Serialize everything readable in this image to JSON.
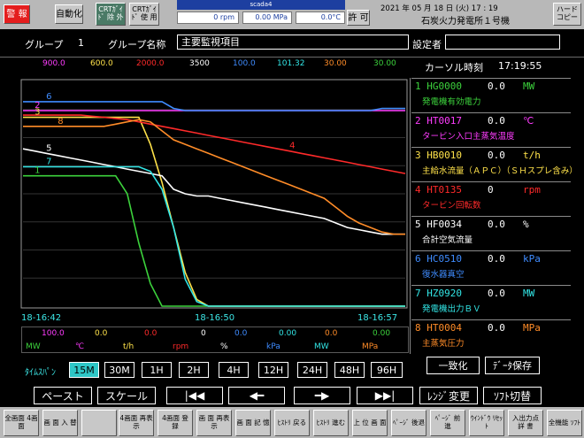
{
  "colors": {
    "s1": "#3cd23c",
    "s2": "#ff3cff",
    "s3": "#ffe24a",
    "s4": "#ff2a2a",
    "s5": "#ffffff",
    "s6": "#3f8cff",
    "s7": "#32e6e6",
    "s8": "#ff8c28"
  },
  "topbar": {
    "alarm": "警 報",
    "auto": "自動化",
    "crt1": "CRTｶﾞｲﾄﾞ 除 外",
    "crt2": "CRTｶﾞｲﾄﾞ 使 用",
    "win_title": "scada4",
    "rpm": "0 rpm",
    "mpa": "0.00 MPa",
    "temp": "0.0°C",
    "permit": "許 可",
    "datetime": "2021 年 05 月 18 日 (火)  17 : 19",
    "plant": "石炭火力発電所１号機",
    "hardcopy": "ハード コピー"
  },
  "header": {
    "group_label": "グループ",
    "group_no": "1",
    "group_name_label": "グループ名称",
    "group_name": "主要監視項目",
    "setter_label": "設定者",
    "setter": ""
  },
  "scale_top": [
    "900.0",
    "600.0",
    "2000.0",
    "3500",
    "100.0",
    "101.32",
    "30.00",
    "30.00"
  ],
  "cursor": {
    "label": "カーソル時刻",
    "time": "17:19:55"
  },
  "chart_data": {
    "type": "line",
    "x": [
      "18-16:42",
      "18-16:50",
      "18-16:57"
    ],
    "y_normalized_range": [
      0,
      1
    ],
    "series": [
      {
        "name": "1",
        "values": [
          0.58,
          0.58,
          0.58,
          0.58,
          0.58,
          0.58,
          0.58,
          0.58,
          0.58,
          0.5,
          0.28,
          0.1,
          0,
          0,
          0,
          0,
          0,
          0,
          0,
          0,
          0,
          0,
          0,
          0,
          0,
          0,
          0,
          0,
          0,
          0,
          0,
          0,
          0,
          0
        ]
      },
      {
        "name": "2",
        "values": [
          0.87,
          0.87,
          0.87,
          0.87,
          0.87,
          0.87,
          0.87,
          0.87,
          0.87,
          0.87,
          0.87,
          0.87,
          0.87,
          0.87,
          0.87,
          0.87,
          0.87,
          0.87,
          0.87,
          0.87,
          0.87,
          0.87,
          0.87,
          0.87,
          0.87,
          0.87,
          0.87,
          0.87,
          0.87,
          0.87,
          0.87,
          0.87,
          0.87,
          0.87
        ]
      },
      {
        "name": "3",
        "values": [
          0.84,
          0.84,
          0.84,
          0.84,
          0.84,
          0.84,
          0.84,
          0.84,
          0.84,
          0.84,
          0.84,
          0.72,
          0.55,
          0.35,
          0.15,
          0.03,
          0,
          0,
          0,
          0,
          0,
          0,
          0,
          0,
          0,
          0,
          0,
          0,
          0,
          0,
          0,
          0,
          0,
          0
        ]
      },
      {
        "name": "4",
        "values": [
          0.85,
          0.85,
          0.85,
          0.85,
          0.85,
          0.85,
          0.845,
          0.84,
          0.835,
          0.83,
          0.82,
          0.81,
          0.8,
          0.79,
          0.78,
          0.77,
          0.76,
          0.75,
          0.74,
          0.73,
          0.72,
          0.71,
          0.7,
          0.69,
          0.68,
          0.67,
          0.66,
          0.65,
          0.64,
          0.63,
          0.62,
          0.61,
          0.6,
          0.59
        ]
      },
      {
        "name": "5",
        "values": [
          0.7,
          0.69,
          0.68,
          0.67,
          0.66,
          0.65,
          0.64,
          0.63,
          0.62,
          0.61,
          0.6,
          0.59,
          0.58,
          0.52,
          0.5,
          0.49,
          0.49,
          0.48,
          0.47,
          0.46,
          0.45,
          0.44,
          0.43,
          0.42,
          0.41,
          0.4,
          0.39,
          0.37,
          0.35,
          0.34,
          0.33,
          0.32,
          0.32,
          0.32
        ]
      },
      {
        "name": "6",
        "values": [
          0.91,
          0.91,
          0.91,
          0.91,
          0.91,
          0.91,
          0.91,
          0.91,
          0.91,
          0.91,
          0.91,
          0.91,
          0.91,
          0.88,
          0.87,
          0.87,
          0.87,
          0.87,
          0.87,
          0.87,
          0.87,
          0.87,
          0.87,
          0.87,
          0.87,
          0.87,
          0.87,
          0.87,
          0.87,
          0.87,
          0.87,
          0.88,
          0.88,
          0.88
        ]
      },
      {
        "name": "7",
        "values": [
          0.62,
          0.62,
          0.62,
          0.62,
          0.62,
          0.62,
          0.62,
          0.62,
          0.62,
          0.62,
          0.62,
          0.6,
          0.52,
          0.35,
          0.12,
          0.02,
          0,
          0,
          0,
          0,
          0,
          0,
          0,
          0,
          0,
          0,
          0,
          0,
          0,
          0,
          0,
          0,
          0,
          0
        ]
      },
      {
        "name": "8",
        "values": [
          0.8,
          0.8,
          0.8,
          0.8,
          0.8,
          0.8,
          0.8,
          0.8,
          0.81,
          0.82,
          0.83,
          0.82,
          0.78,
          0.74,
          0.72,
          0.7,
          0.68,
          0.66,
          0.64,
          0.62,
          0.6,
          0.58,
          0.56,
          0.54,
          0.52,
          0.5,
          0.48,
          0.44,
          0.4,
          0.37,
          0.35,
          0.33,
          0.32,
          0.32
        ]
      }
    ]
  },
  "legend": [
    {
      "tag": "1 HG0000",
      "value": "0.0",
      "unit": "MW",
      "desc": "発電機有効電力"
    },
    {
      "tag": "2 HT0017",
      "value": "0.0",
      "unit": "℃",
      "desc": "タービン入口主蒸気温度"
    },
    {
      "tag": "3 HB0010",
      "value": "0.0",
      "unit": "t/h",
      "desc": "主給水流量（ＡＰＣ）（ＳＨスプレ含み）"
    },
    {
      "tag": "4 HT0135",
      "value": "0",
      "unit": "rpm",
      "desc": "タービン回転数"
    },
    {
      "tag": "5 HF0034",
      "value": "0.0",
      "unit": "%",
      "desc": "合計空気流量"
    },
    {
      "tag": "6 HC0510",
      "value": "0.0",
      "unit": "kPa",
      "desc": "復水器真空"
    },
    {
      "tag": "7 HZ0920",
      "value": "0.0",
      "unit": "MW",
      "desc": "発電機出力ＢＶ"
    },
    {
      "tag": "8 HT0004",
      "value": "0.0",
      "unit": "MPa",
      "desc": "主蒸気圧力"
    }
  ],
  "scale_bottom": [
    "100.0",
    "0.0",
    "0.0",
    "0",
    "0.0",
    "0.00",
    "0.0",
    "0.00"
  ],
  "units_bottom": [
    "MW",
    "℃",
    "t/h",
    "rpm",
    "%",
    "kPa",
    "MW",
    "MPa"
  ],
  "time_span": {
    "label": "ﾀｲﾑｽﾊﾟﾝ",
    "options": [
      "15M",
      "30M",
      "1H",
      "2H",
      "4H",
      "12H",
      "24H",
      "48H",
      "96H"
    ],
    "selected": "15M"
  },
  "actions": {
    "match": "一致化",
    "save": "ﾃﾞｰﾀ保存",
    "paste": "ペースト",
    "scale": "スケール",
    "first": "|◀◀",
    "prev": "◀━",
    "next": "━▶",
    "last": "▶▶|",
    "range": "ﾚﾝｼﾞ変更",
    "soft": "ｿﾌﾄ切替"
  },
  "fkeys": [
    "全画面 4画面",
    "画 面 入 替",
    "",
    "4画面 再表示",
    "4画面 登 録",
    "画 面 再表示",
    "画 面 記 憶",
    "ﾋｽﾄﾘ 戻る",
    "ﾋｽﾄﾘ 進む",
    "上 位 画 面",
    "ﾍﾟｰｼﾞ 後退",
    "ﾍﾟｰｼﾞ 前 進",
    "ｳｲﾝﾄﾞｳ ﾘｾｯﾄ",
    "入出力点 詳 書",
    "全機能 ｿﾌﾄ"
  ]
}
